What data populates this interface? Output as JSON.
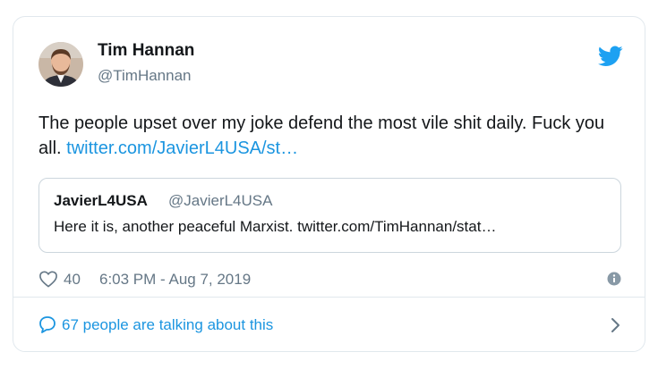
{
  "author": {
    "name": "Tim Hannan",
    "handle": "@TimHannan"
  },
  "tweet": {
    "text": "The people upset over my joke defend the most vile shit daily. Fuck you all.",
    "link": "twitter.com/JavierL4USA/st…"
  },
  "quoted_tweet": {
    "name": "JavierL4USA",
    "handle": "@JavierL4USA",
    "text": "Here it is, another peaceful Marxist. twitter.com/TimHannan/stat…"
  },
  "meta": {
    "likes": "40",
    "timestamp": "6:03 PM - Aug 7, 2019"
  },
  "conversation": {
    "label": "67 people are talking about this"
  },
  "icons": {
    "brand": "twitter-bird-icon",
    "like": "heart-icon",
    "info": "info-icon",
    "comment": "comment-bubble-icon",
    "chevron": "chevron-right-icon"
  },
  "colors": {
    "link": "#1b95e0",
    "brand": "#1da1f2",
    "muted": "#657786",
    "border": "#e1e8ed"
  }
}
